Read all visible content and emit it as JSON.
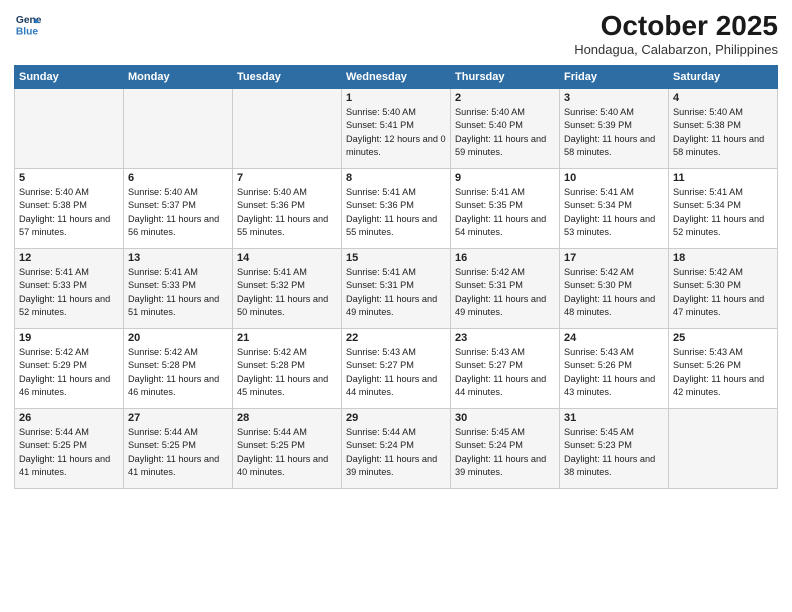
{
  "header": {
    "logo_line1": "General",
    "logo_line2": "Blue",
    "month": "October 2025",
    "location": "Hondagua, Calabarzon, Philippines"
  },
  "weekdays": [
    "Sunday",
    "Monday",
    "Tuesday",
    "Wednesday",
    "Thursday",
    "Friday",
    "Saturday"
  ],
  "weeks": [
    [
      {
        "day": "",
        "sunrise": "",
        "sunset": "",
        "daylight": ""
      },
      {
        "day": "",
        "sunrise": "",
        "sunset": "",
        "daylight": ""
      },
      {
        "day": "",
        "sunrise": "",
        "sunset": "",
        "daylight": ""
      },
      {
        "day": "1",
        "sunrise": "Sunrise: 5:40 AM",
        "sunset": "Sunset: 5:41 PM",
        "daylight": "Daylight: 12 hours and 0 minutes."
      },
      {
        "day": "2",
        "sunrise": "Sunrise: 5:40 AM",
        "sunset": "Sunset: 5:40 PM",
        "daylight": "Daylight: 11 hours and 59 minutes."
      },
      {
        "day": "3",
        "sunrise": "Sunrise: 5:40 AM",
        "sunset": "Sunset: 5:39 PM",
        "daylight": "Daylight: 11 hours and 58 minutes."
      },
      {
        "day": "4",
        "sunrise": "Sunrise: 5:40 AM",
        "sunset": "Sunset: 5:38 PM",
        "daylight": "Daylight: 11 hours and 58 minutes."
      }
    ],
    [
      {
        "day": "5",
        "sunrise": "Sunrise: 5:40 AM",
        "sunset": "Sunset: 5:38 PM",
        "daylight": "Daylight: 11 hours and 57 minutes."
      },
      {
        "day": "6",
        "sunrise": "Sunrise: 5:40 AM",
        "sunset": "Sunset: 5:37 PM",
        "daylight": "Daylight: 11 hours and 56 minutes."
      },
      {
        "day": "7",
        "sunrise": "Sunrise: 5:40 AM",
        "sunset": "Sunset: 5:36 PM",
        "daylight": "Daylight: 11 hours and 55 minutes."
      },
      {
        "day": "8",
        "sunrise": "Sunrise: 5:41 AM",
        "sunset": "Sunset: 5:36 PM",
        "daylight": "Daylight: 11 hours and 55 minutes."
      },
      {
        "day": "9",
        "sunrise": "Sunrise: 5:41 AM",
        "sunset": "Sunset: 5:35 PM",
        "daylight": "Daylight: 11 hours and 54 minutes."
      },
      {
        "day": "10",
        "sunrise": "Sunrise: 5:41 AM",
        "sunset": "Sunset: 5:34 PM",
        "daylight": "Daylight: 11 hours and 53 minutes."
      },
      {
        "day": "11",
        "sunrise": "Sunrise: 5:41 AM",
        "sunset": "Sunset: 5:34 PM",
        "daylight": "Daylight: 11 hours and 52 minutes."
      }
    ],
    [
      {
        "day": "12",
        "sunrise": "Sunrise: 5:41 AM",
        "sunset": "Sunset: 5:33 PM",
        "daylight": "Daylight: 11 hours and 52 minutes."
      },
      {
        "day": "13",
        "sunrise": "Sunrise: 5:41 AM",
        "sunset": "Sunset: 5:33 PM",
        "daylight": "Daylight: 11 hours and 51 minutes."
      },
      {
        "day": "14",
        "sunrise": "Sunrise: 5:41 AM",
        "sunset": "Sunset: 5:32 PM",
        "daylight": "Daylight: 11 hours and 50 minutes."
      },
      {
        "day": "15",
        "sunrise": "Sunrise: 5:41 AM",
        "sunset": "Sunset: 5:31 PM",
        "daylight": "Daylight: 11 hours and 49 minutes."
      },
      {
        "day": "16",
        "sunrise": "Sunrise: 5:42 AM",
        "sunset": "Sunset: 5:31 PM",
        "daylight": "Daylight: 11 hours and 49 minutes."
      },
      {
        "day": "17",
        "sunrise": "Sunrise: 5:42 AM",
        "sunset": "Sunset: 5:30 PM",
        "daylight": "Daylight: 11 hours and 48 minutes."
      },
      {
        "day": "18",
        "sunrise": "Sunrise: 5:42 AM",
        "sunset": "Sunset: 5:30 PM",
        "daylight": "Daylight: 11 hours and 47 minutes."
      }
    ],
    [
      {
        "day": "19",
        "sunrise": "Sunrise: 5:42 AM",
        "sunset": "Sunset: 5:29 PM",
        "daylight": "Daylight: 11 hours and 46 minutes."
      },
      {
        "day": "20",
        "sunrise": "Sunrise: 5:42 AM",
        "sunset": "Sunset: 5:28 PM",
        "daylight": "Daylight: 11 hours and 46 minutes."
      },
      {
        "day": "21",
        "sunrise": "Sunrise: 5:42 AM",
        "sunset": "Sunset: 5:28 PM",
        "daylight": "Daylight: 11 hours and 45 minutes."
      },
      {
        "day": "22",
        "sunrise": "Sunrise: 5:43 AM",
        "sunset": "Sunset: 5:27 PM",
        "daylight": "Daylight: 11 hours and 44 minutes."
      },
      {
        "day": "23",
        "sunrise": "Sunrise: 5:43 AM",
        "sunset": "Sunset: 5:27 PM",
        "daylight": "Daylight: 11 hours and 44 minutes."
      },
      {
        "day": "24",
        "sunrise": "Sunrise: 5:43 AM",
        "sunset": "Sunset: 5:26 PM",
        "daylight": "Daylight: 11 hours and 43 minutes."
      },
      {
        "day": "25",
        "sunrise": "Sunrise: 5:43 AM",
        "sunset": "Sunset: 5:26 PM",
        "daylight": "Daylight: 11 hours and 42 minutes."
      }
    ],
    [
      {
        "day": "26",
        "sunrise": "Sunrise: 5:44 AM",
        "sunset": "Sunset: 5:25 PM",
        "daylight": "Daylight: 11 hours and 41 minutes."
      },
      {
        "day": "27",
        "sunrise": "Sunrise: 5:44 AM",
        "sunset": "Sunset: 5:25 PM",
        "daylight": "Daylight: 11 hours and 41 minutes."
      },
      {
        "day": "28",
        "sunrise": "Sunrise: 5:44 AM",
        "sunset": "Sunset: 5:25 PM",
        "daylight": "Daylight: 11 hours and 40 minutes."
      },
      {
        "day": "29",
        "sunrise": "Sunrise: 5:44 AM",
        "sunset": "Sunset: 5:24 PM",
        "daylight": "Daylight: 11 hours and 39 minutes."
      },
      {
        "day": "30",
        "sunrise": "Sunrise: 5:45 AM",
        "sunset": "Sunset: 5:24 PM",
        "daylight": "Daylight: 11 hours and 39 minutes."
      },
      {
        "day": "31",
        "sunrise": "Sunrise: 5:45 AM",
        "sunset": "Sunset: 5:23 PM",
        "daylight": "Daylight: 11 hours and 38 minutes."
      },
      {
        "day": "",
        "sunrise": "",
        "sunset": "",
        "daylight": ""
      }
    ]
  ]
}
